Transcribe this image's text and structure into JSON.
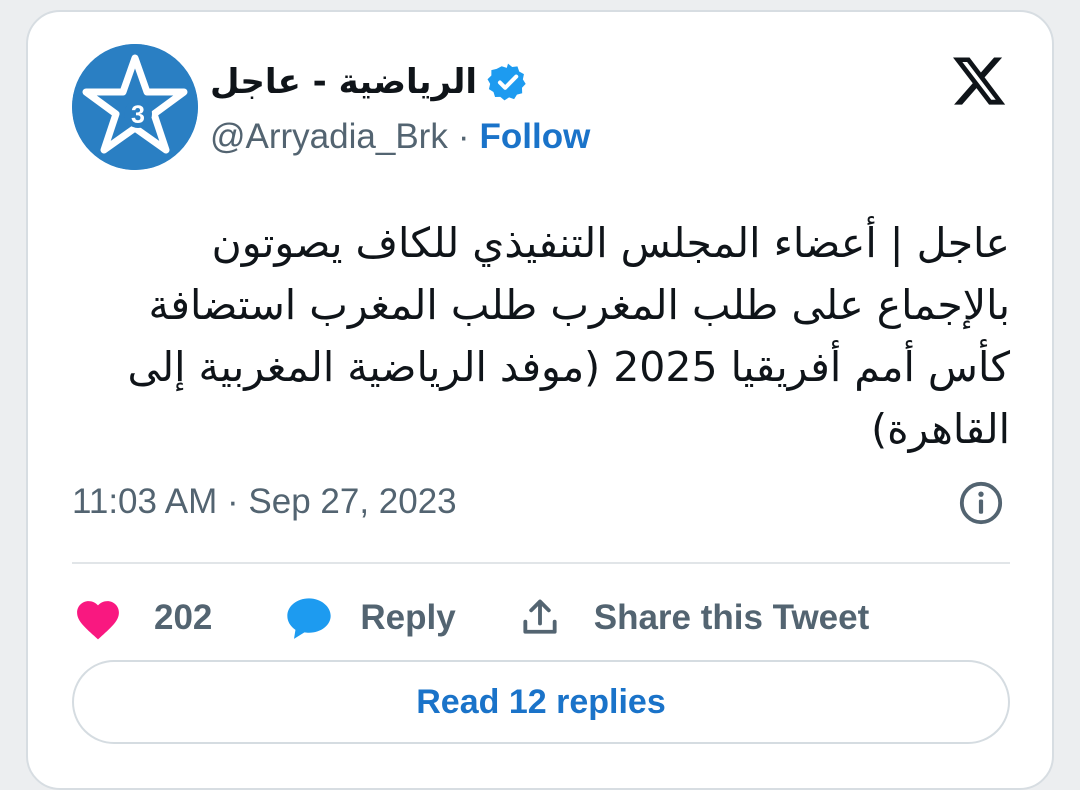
{
  "account": {
    "display_name": "الرياضية - عاجل",
    "handle": "@Arryadia_Brk",
    "separator": "·",
    "follow_label": "Follow",
    "avatar_badge": "3",
    "verified_icon": "verified-badge-icon"
  },
  "tweet": {
    "text": "عاجل | أعضاء المجلس التنفيذي للكاف يصوتون بالإجماع على طلب المغرب طلب المغرب استضافة كأس أمم أفريقيا 2025 (موفد الرياضية المغربية إلى القاهرة)",
    "timestamp": "11:03 AM · Sep 27, 2023"
  },
  "actions": {
    "like_count": "202",
    "reply_label": "Reply",
    "share_label": "Share this Tweet"
  },
  "footer": {
    "read_replies_label": "Read 12 replies"
  },
  "colors": {
    "accent": "#1a73c9",
    "avatar_bg": "#2a7fc3",
    "verified": "#1d9bf0",
    "like": "#f91880",
    "reply_bubble": "#1d9bf0",
    "muted_text": "#536471"
  },
  "icons": [
    "x-logo-icon",
    "verified-badge-icon",
    "info-icon",
    "heart-icon",
    "speech-bubble-icon",
    "share-upload-icon"
  ]
}
